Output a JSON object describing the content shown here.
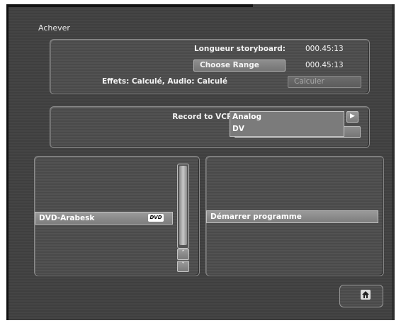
{
  "app": {
    "title": "Achever"
  },
  "storyboard": {
    "length_label": "Longueur storyboard:",
    "length_value": "000.45:13",
    "range_button": "Choose Range",
    "range_value": "000.45:13",
    "effects_status": "Effets: Calculé, Audio: Calculé",
    "calculate_button": "Calculer"
  },
  "record": {
    "label": "Record to VCR",
    "options": [
      "Analog",
      "DV"
    ],
    "arrow_icon": "play-arrow-icon"
  },
  "projects": {
    "items": [
      "DVD-Arabesk"
    ],
    "item_badge": "DVD",
    "scroll_up_icon": "chevron-up-icon",
    "scroll_down_icon": "chevron-down-icon"
  },
  "actions": {
    "start_program": "Démarrer programme"
  },
  "home": {
    "icon": "home-icon"
  }
}
